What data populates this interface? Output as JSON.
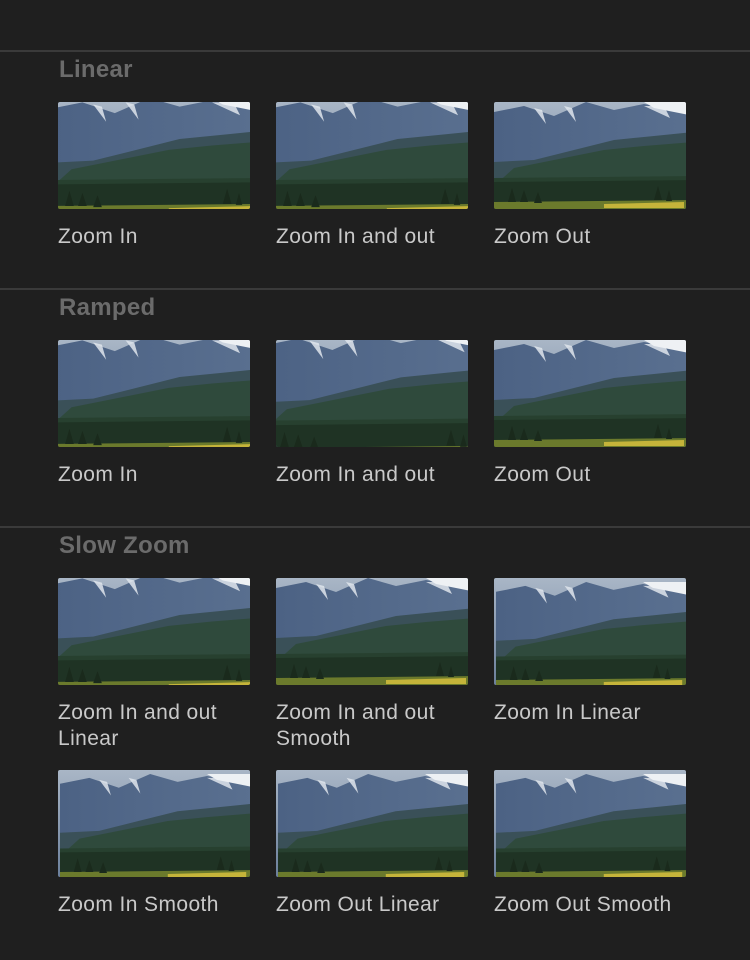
{
  "colors": {
    "background": "#1f1f1f",
    "divider": "#3a3a3a",
    "section_title": "#6b6b6b",
    "label": "#c9c9c9"
  },
  "sections": [
    {
      "title": "Linear",
      "items": [
        {
          "label": "Zoom In",
          "icon": "landscape-thumbnail"
        },
        {
          "label": "Zoom In and out",
          "icon": "landscape-thumbnail"
        },
        {
          "label": "Zoom Out",
          "icon": "landscape-thumbnail"
        }
      ]
    },
    {
      "title": "Ramped",
      "items": [
        {
          "label": "Zoom In",
          "icon": "landscape-thumbnail"
        },
        {
          "label": "Zoom In and out",
          "icon": "landscape-thumbnail"
        },
        {
          "label": "Zoom Out",
          "icon": "landscape-thumbnail"
        }
      ]
    },
    {
      "title": "Slow Zoom",
      "items": [
        {
          "label": "Zoom In and out Linear",
          "icon": "landscape-thumbnail"
        },
        {
          "label": "Zoom In and out Smooth",
          "icon": "landscape-thumbnail"
        },
        {
          "label": "Zoom In Linear",
          "icon": "landscape-thumbnail"
        },
        {
          "label": "Zoom In Smooth",
          "icon": "landscape-thumbnail"
        },
        {
          "label": "Zoom Out Linear",
          "icon": "landscape-thumbnail"
        },
        {
          "label": "Zoom Out Smooth",
          "icon": "landscape-thumbnail"
        }
      ]
    }
  ]
}
